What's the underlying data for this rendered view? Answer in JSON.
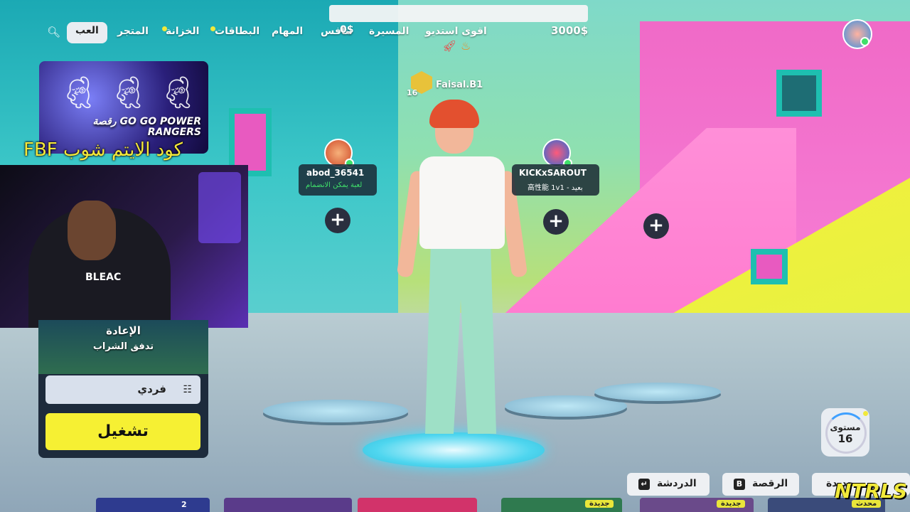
{
  "nav": {
    "search_icon": "search-icon",
    "items": [
      {
        "label": "العب",
        "active": true
      },
      {
        "label": "المتجر"
      },
      {
        "label": "الخزانة"
      },
      {
        "label": "البطاقات"
      },
      {
        "label": "المهام"
      },
      {
        "label": "تنافس"
      },
      {
        "label": "المسيرة"
      },
      {
        "label": "اقوى استديو"
      }
    ],
    "currency": "3000$",
    "currency2": "0$"
  },
  "promo": {
    "title": "رقصة GO GO POWER RANGERS",
    "code_text": "FBF كود الايتم شوب"
  },
  "webcam": {
    "shirt_text": "BLEAC"
  },
  "mode": {
    "title": "الإعادة",
    "subtitle": "تدفق الشراب",
    "squad_label": "فردي",
    "play_label": "تشغيل"
  },
  "lobby": {
    "main_player": {
      "name": "Faisal.B1",
      "level": "16"
    },
    "party": [
      {
        "name": "abod_36541",
        "status": "لعبة يمكن الانضمام",
        "status_color": "#3fe06a"
      },
      {
        "name": "KICKxSAROUT",
        "status": "高性能 1v1 - بعيد",
        "status_color": "#ffffff"
      }
    ]
  },
  "level_box": {
    "label": "مستوى",
    "value": "16"
  },
  "bottom_buttons": {
    "chat": "الدردشة",
    "chat_key": "↵",
    "emote": "الرقصة",
    "emote_key": "B",
    "new": "جديدة"
  },
  "strip": {
    "badge_count": "2",
    "tags": [
      "جديدة",
      "جديدة",
      "محدث"
    ]
  },
  "watermark": "NTRLS",
  "colors": {
    "accent_yellow": "#f6f033",
    "online_green": "#3fe06a"
  }
}
